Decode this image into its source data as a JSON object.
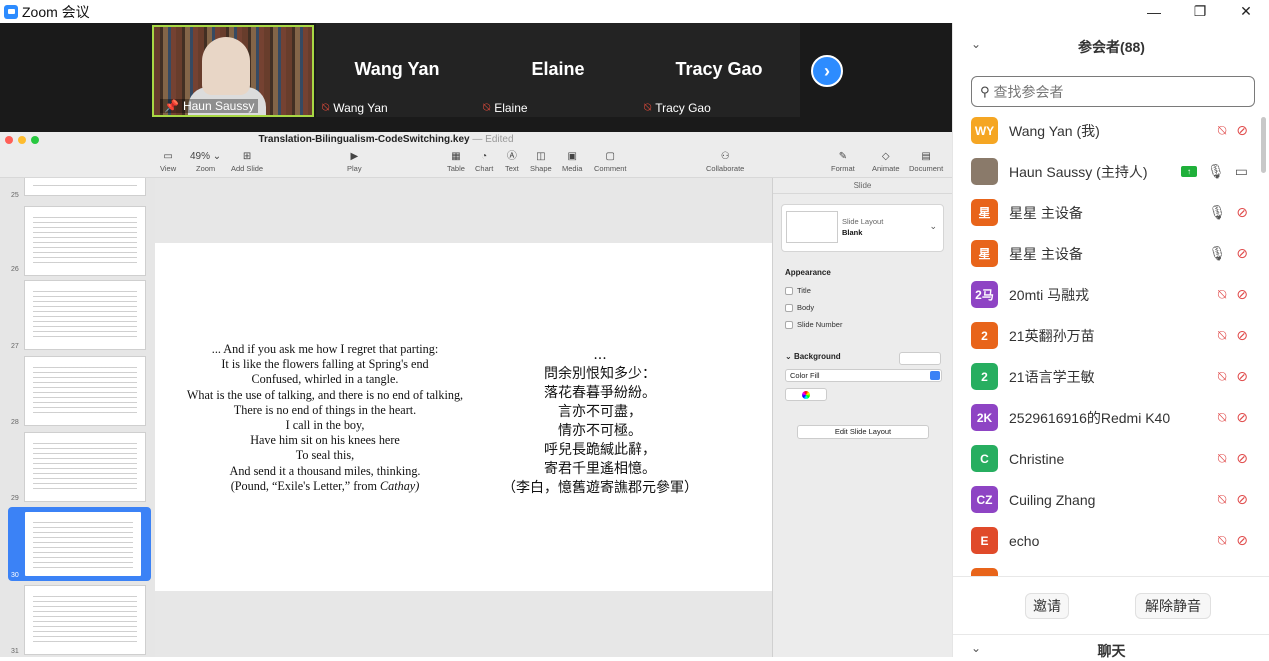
{
  "window": {
    "title": "Zoom 会议",
    "minimize": "—",
    "restore": "❐",
    "close": "✕"
  },
  "videos": [
    {
      "name": "Haun Saussy",
      "pinned": true
    },
    {
      "name": "Wang Yan",
      "label": "Wang Yan",
      "muted": true
    },
    {
      "name": "Elaine",
      "label": "Elaine",
      "muted": true
    },
    {
      "name": "Tracy Gao",
      "label": "Tracy Gao",
      "muted": true
    }
  ],
  "keynote": {
    "doc_title": "Translation-Bilingualism-CodeSwitching.key",
    "doc_status": "— Edited",
    "toolbar": {
      "view": "View",
      "zoom_value": "49% ⌄",
      "zoom": "Zoom",
      "add_slide": "Add Slide",
      "play": "Play",
      "table": "Table",
      "chart": "Chart",
      "text": "Text",
      "shape": "Shape",
      "media": "Media",
      "comment": "Comment",
      "collaborate": "Collaborate",
      "format": "Format",
      "animate": "Animate",
      "document": "Document"
    },
    "slide_numbers": [
      "25",
      "26",
      "27",
      "28",
      "29",
      "30",
      "31"
    ],
    "english_poem": [
      "... And if you ask me how I regret that parting:",
      "It is like the flowers falling at Spring's end",
      "Confused, whirled in a tangle.",
      "What is the use of talking, and there is no end of talking,",
      "There is no end of things in the heart.",
      "I call in the boy,",
      "Have him sit on his knees here",
      "To seal this,",
      "And send it a thousand miles, thinking.",
      "(Pound, “Exile's Letter,” from ",
      "Cathay)"
    ],
    "chinese_poem": [
      "...",
      "問余別恨知多少：",
      "落花春暮爭紛紛。",
      "言亦不可盡，",
      "情亦不可極。",
      "呼兒長跪緘此辭，",
      "寄君千里遙相憶。",
      "（李白，憶舊遊寄譙郡元參軍）"
    ],
    "inspector": {
      "tab": "Slide",
      "layout_label": "Slide Layout",
      "layout_value": "Blank",
      "appearance": "Appearance",
      "checks": [
        "Title",
        "Body",
        "Slide Number"
      ],
      "background": "Background",
      "fill": "Color Fill",
      "edit_layout": "Edit Slide Layout"
    }
  },
  "panel": {
    "title": "参会者(88)",
    "search_placeholder": "查找参会者",
    "participants": [
      {
        "initials": "WY",
        "name": "Wang Yan (我)",
        "color": "#f5a623",
        "mic": "off",
        "cam": "off"
      },
      {
        "initials": "",
        "name": "Haun Saussy (主持人)",
        "color": "#8a7a6a",
        "mic": "on",
        "cam": "on",
        "sharing": true
      },
      {
        "initials": "星",
        "name": "星星 主设备",
        "color": "#e8641a",
        "mic": "on",
        "cam": "off"
      },
      {
        "initials": "星",
        "name": "星星 主设备",
        "color": "#e8641a",
        "mic": "on",
        "cam": "off"
      },
      {
        "initials": "2马",
        "name": "20mti 马融戎",
        "color": "#8e44c4",
        "mic": "off",
        "cam": "off"
      },
      {
        "initials": "2",
        "name": "21英翻孙万苗",
        "color": "#e8641a",
        "mic": "off",
        "cam": "off"
      },
      {
        "initials": "2",
        "name": "21语言学王敏",
        "color": "#27ae60",
        "mic": "off",
        "cam": "off"
      },
      {
        "initials": "2K",
        "name": "2529616916的Redmi K40",
        "color": "#8e44c4",
        "mic": "off",
        "cam": "off"
      },
      {
        "initials": "C",
        "name": "Christine",
        "color": "#27ae60",
        "mic": "off",
        "cam": "off"
      },
      {
        "initials": "CZ",
        "name": "Cuiling Zhang",
        "color": "#8e44c4",
        "mic": "off",
        "cam": "off"
      },
      {
        "initials": "E",
        "name": "echo",
        "color": "#e04a2a",
        "mic": "off",
        "cam": "off"
      },
      {
        "initials": "",
        "name": "",
        "color": "#e8641a",
        "mic": "off",
        "cam": "off"
      }
    ],
    "invite": "邀请",
    "unmute": "解除静音",
    "chat_title": "聊天"
  }
}
